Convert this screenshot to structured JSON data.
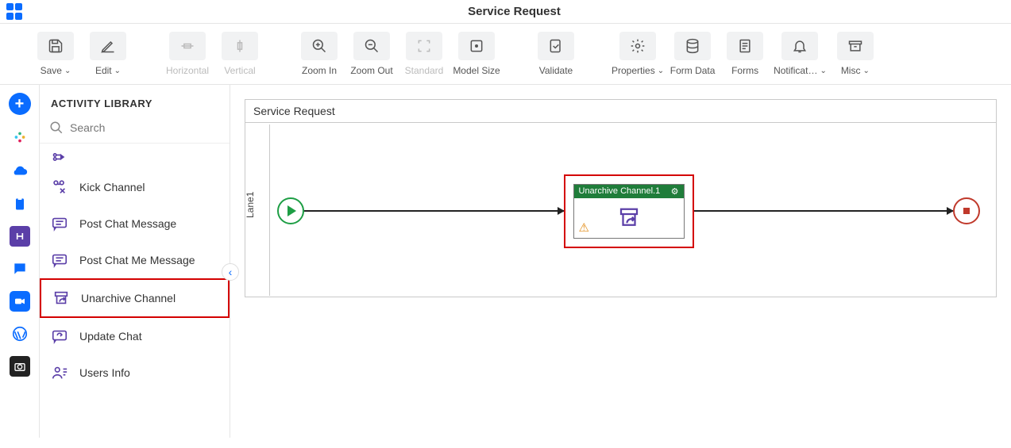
{
  "header": {
    "title": "Service Request"
  },
  "toolbar": {
    "save": "Save",
    "edit": "Edit",
    "horizontal": "Horizontal",
    "vertical": "Vertical",
    "zoom_in": "Zoom In",
    "zoom_out": "Zoom Out",
    "standard": "Standard",
    "model_size": "Model Size",
    "validate": "Validate",
    "properties": "Properties",
    "form_data": "Form Data",
    "forms": "Forms",
    "notifications": "Notificat…",
    "misc": "Misc"
  },
  "library": {
    "title": "ACTIVITY LIBRARY",
    "search_placeholder": "Search",
    "items": [
      {
        "label": "Kick Channel"
      },
      {
        "label": "Post Chat Message"
      },
      {
        "label": "Post Chat Me Message"
      },
      {
        "label": "Unarchive Channel"
      },
      {
        "label": "Update Chat"
      },
      {
        "label": "Users Info"
      }
    ],
    "highlight_label": "Unarchive Channel"
  },
  "canvas": {
    "title": "Service Request",
    "lane": "Lane1",
    "activity": {
      "title": "Unarchive Channel.1"
    }
  }
}
